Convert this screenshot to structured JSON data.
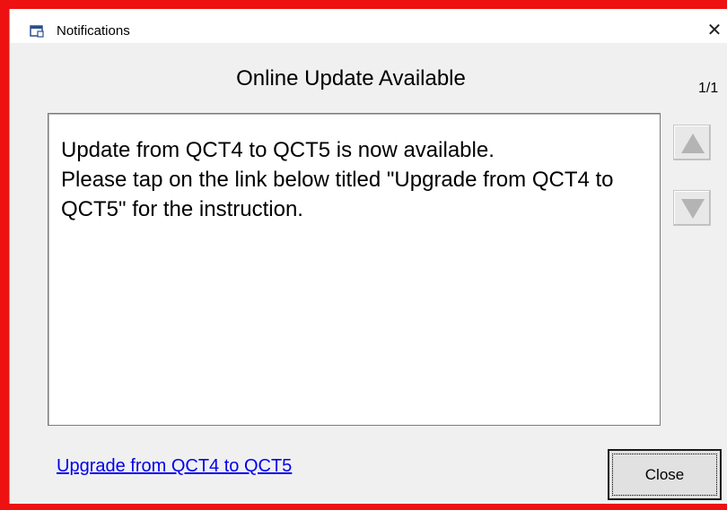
{
  "window": {
    "title": "Notifications",
    "close_glyph": "✕",
    "icon": "window-icon"
  },
  "notification": {
    "heading": "Online Update Available",
    "page_counter": "1/1",
    "message": "Update from QCT4 to QCT5 is now available.\nPlease tap on the link below titled \"Upgrade from QCT4 to QCT5\" for the instruction."
  },
  "nav": {
    "up_icon": "triangle-up-icon",
    "down_icon": "triangle-down-icon"
  },
  "footer": {
    "link_text": "Upgrade from QCT4 to QCT5",
    "close_label": "Close"
  },
  "colors": {
    "frame_highlight": "#ee1111",
    "link": "#0000ee",
    "arrow": "#b4b4b4"
  }
}
